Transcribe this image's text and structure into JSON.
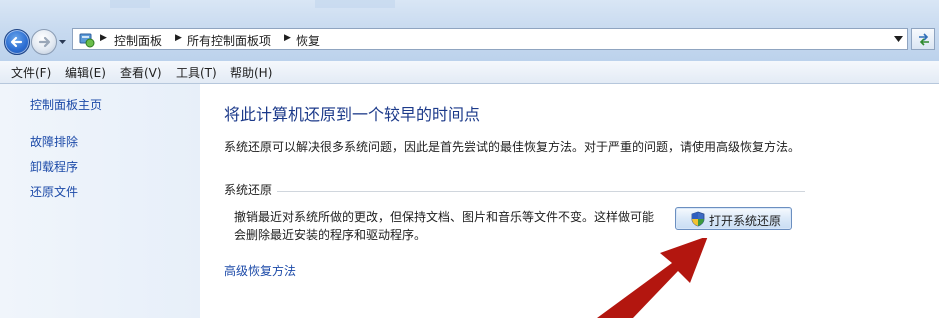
{
  "address_bar": {
    "breadcrumbs": [
      "控制面板",
      "所有控制面板项",
      "恢复"
    ]
  },
  "menu": [
    "文件(F)",
    "编辑(E)",
    "查看(V)",
    "工具(T)",
    "帮助(H)"
  ],
  "sidebar": {
    "home": "控制面板主页",
    "links": [
      "故障排除",
      "卸载程序",
      "还原文件"
    ]
  },
  "main": {
    "title": "将此计算机还原到一个较早的时间点",
    "description": "系统还原可以解决很多系统问题，因此是首先尝试的最佳恢复方法。对于严重的问题，请使用高级恢复方法。",
    "system_restore": {
      "heading": "系统还原",
      "text_line1": "撤销最近对系统所做的更改，但保持文档、图片和音乐等文件不变。这样做可能",
      "text_line2": "会删除最近安装的程序和驱动程序。",
      "button": "打开系统还原"
    },
    "advanced_link": "高级恢复方法"
  },
  "colors": {
    "link": "#1c4aa8",
    "title": "#1c3a8a",
    "annotation_arrow": "#b3160f"
  },
  "icons": [
    "back-arrow-icon",
    "forward-arrow-icon",
    "control-panel-icon",
    "refresh-icon",
    "uac-shield-icon"
  ]
}
